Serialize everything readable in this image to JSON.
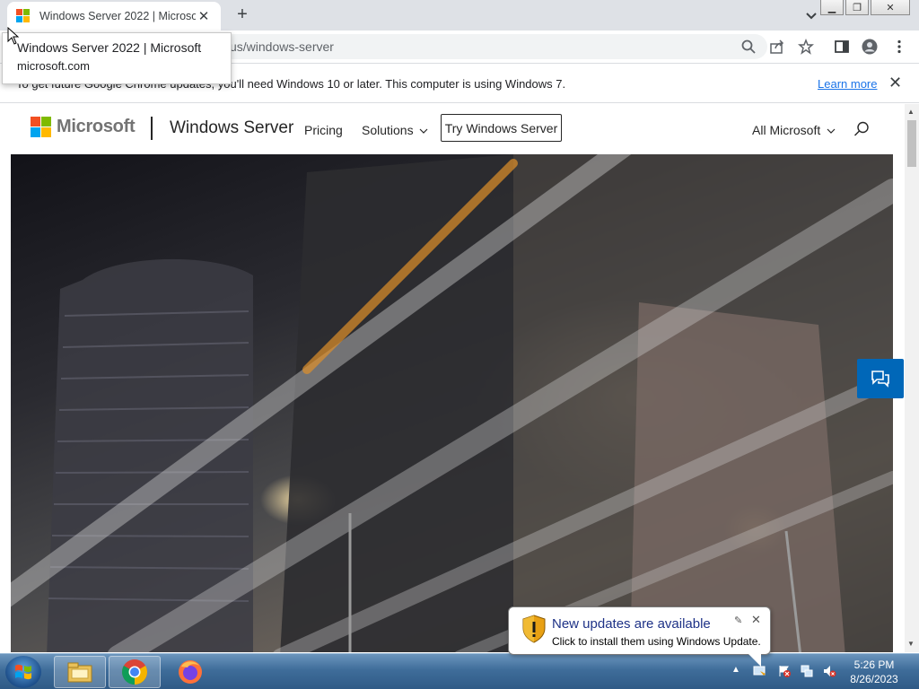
{
  "browser": {
    "tab_title": "Windows Server 2022 | Microsoft",
    "url_fragment": "us/windows-server",
    "tooltip": {
      "title": "Windows Server 2022 | Microsoft",
      "domain": "microsoft.com"
    },
    "infobar": {
      "message": "To get future Google Chrome updates, you'll need Windows 10 or later. This computer is using Windows 7.",
      "link": "Learn more"
    }
  },
  "page": {
    "brand": "Microsoft",
    "product": "Windows Server",
    "nav": {
      "pricing": "Pricing",
      "solutions": "Solutions"
    },
    "cta": "Try Windows Server",
    "all_microsoft": "All Microsoft"
  },
  "notification": {
    "title": "New updates are available",
    "body": "Click to install them using Windows Update."
  },
  "taskbar": {
    "time": "5:26 PM",
    "date": "8/26/2023"
  },
  "icons": [
    "chevron-down-icon",
    "search-icon",
    "share-icon",
    "star-icon",
    "sidebar-icon",
    "profile-icon",
    "menu-icon",
    "close-icon",
    "chat-icon",
    "shield-icon",
    "windows-start-icon",
    "explorer-icon",
    "chrome-icon",
    "firefox-icon"
  ],
  "colors": {
    "ms_blue": "#0067b8",
    "link_blue": "#1a73e8",
    "ms_red": "#f25022",
    "ms_green": "#7fba00",
    "ms_cyan": "#00a4ef",
    "ms_yellow": "#ffb900"
  }
}
